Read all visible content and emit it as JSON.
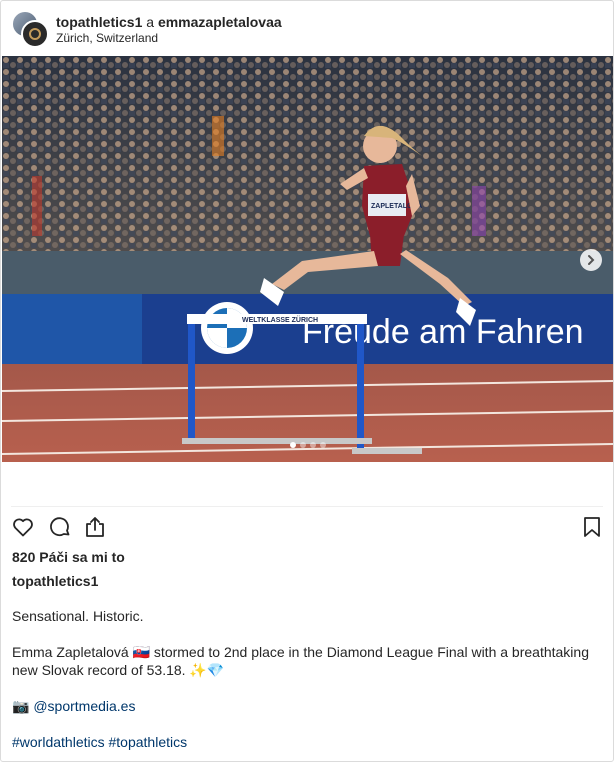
{
  "header": {
    "user1": "topathletics1",
    "conjunction": "a",
    "user2": "emmazapletalovaa",
    "location": "Zürich, Switzerland"
  },
  "photo": {
    "banner_text": "WELTKLASSE ZÜRICH",
    "bib_text": "ZAPLETALOVÁ",
    "ad_text": "Freude am Fahren",
    "carousel": {
      "total": 4,
      "active": 1
    }
  },
  "post": {
    "likes": "820 Páči sa mi to",
    "author": "topathletics1",
    "caption_line1": "Sensational. Historic.",
    "caption_line2": "Emma Zapletalová 🇸🇰 stormed to 2nd place in the Diamond League Final with a breathtaking new Slovak record of 53.18. ✨💎",
    "credit_prefix": "📷",
    "credit_link": "@sportmedia.es",
    "hashtag1": "#worldathletics",
    "hashtag2": "#topathletics"
  },
  "icons": {
    "like": "heart-icon",
    "comment": "comment-icon",
    "share": "share-icon",
    "save": "bookmark-icon",
    "next": "chevron-right-icon"
  }
}
